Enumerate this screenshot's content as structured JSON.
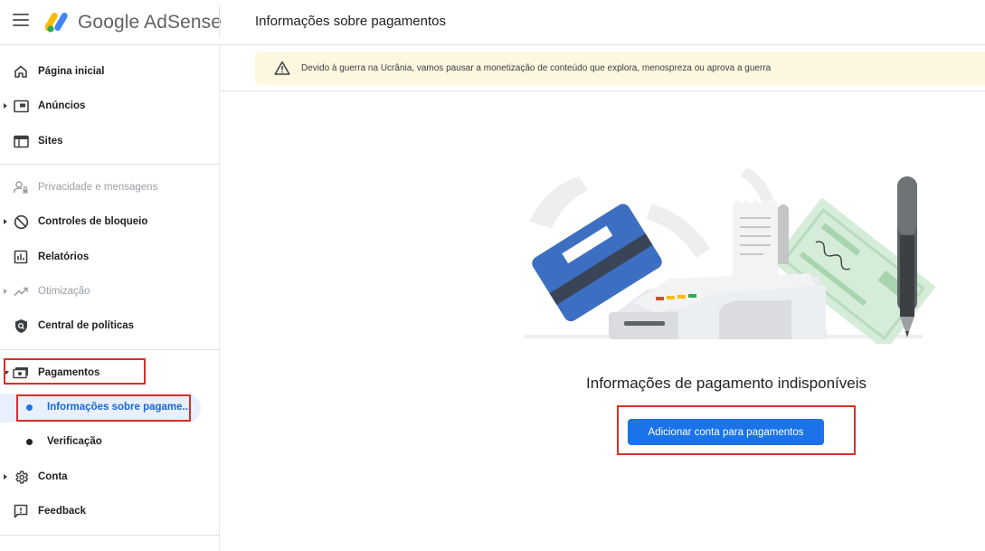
{
  "app": {
    "brand": "Google AdSense",
    "page_title": "Informações sobre pagamentos"
  },
  "sidebar": {
    "items": [
      {
        "label": "Página inicial",
        "icon": "home-icon"
      },
      {
        "label": "Anúncios",
        "icon": "ads-icon"
      },
      {
        "label": "Sites",
        "icon": "sites-icon"
      },
      {
        "label": "Privacidade e mensagens",
        "icon": "privacy-icon",
        "disabled": true
      },
      {
        "label": "Controles de bloqueio",
        "icon": "block-icon"
      },
      {
        "label": "Relatórios",
        "icon": "reports-icon"
      },
      {
        "label": "Otimização",
        "icon": "optimization-icon",
        "disabled": true
      },
      {
        "label": "Central de políticas",
        "icon": "policy-shield-icon"
      },
      {
        "label": "Pagamentos",
        "icon": "payments-icon",
        "expanded": true
      },
      {
        "label": "Conta",
        "icon": "gear-icon"
      },
      {
        "label": "Feedback",
        "icon": "feedback-icon"
      }
    ],
    "payments_sub": [
      {
        "label": "Informações sobre pagame...",
        "active": true
      },
      {
        "label": "Verificação",
        "active": false
      }
    ]
  },
  "banner": {
    "icon": "warning-icon",
    "text": "Devido à guerra na Ucrânia, vamos pausar a monetização de conteúdo que explora, menospreza ou aprova a guerra"
  },
  "empty_state": {
    "title": "Informações de pagamento indisponíveis",
    "button_label": "Adicionar conta para pagamentos"
  },
  "colors": {
    "primary": "#1a73e8",
    "banner_bg": "#fef7e0",
    "highlight_box": "#d93025",
    "active_bg": "#e8f0fe"
  }
}
